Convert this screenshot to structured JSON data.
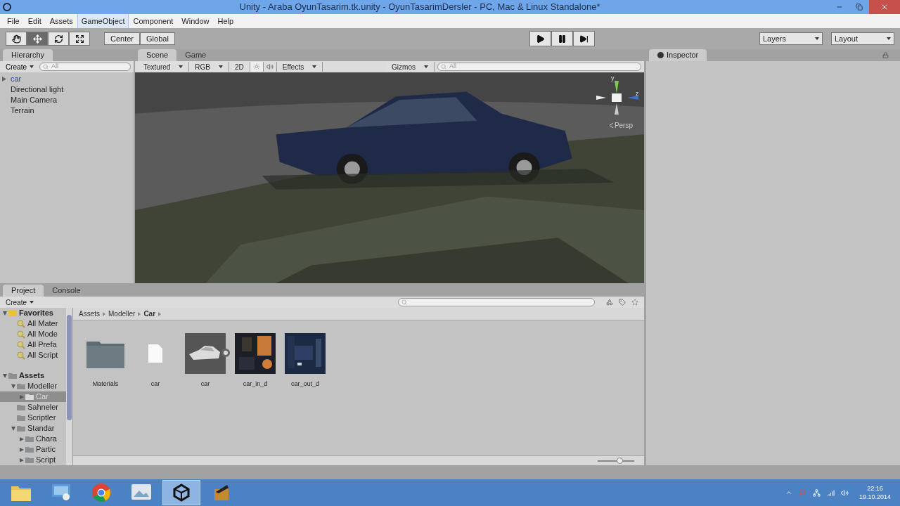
{
  "window": {
    "title": "Unity - Araba OyunTasarim.tk.unity - OyunTasarimDersler - PC, Mac & Linux Standalone*"
  },
  "menu": [
    {
      "label": "File",
      "highlighted": false
    },
    {
      "label": "Edit",
      "highlighted": false
    },
    {
      "label": "Assets",
      "highlighted": false
    },
    {
      "label": "GameObject",
      "highlighted": true
    },
    {
      "label": "Component",
      "highlighted": false
    },
    {
      "label": "Window",
      "highlighted": false
    },
    {
      "label": "Help",
      "highlighted": false
    }
  ],
  "toolbar": {
    "tools": [
      {
        "kind": "hand",
        "selected": false
      },
      {
        "kind": "move",
        "selected": true
      },
      {
        "kind": "rotate",
        "selected": false
      },
      {
        "kind": "scale",
        "selected": false
      }
    ],
    "pivot": [
      "Center",
      "Global"
    ],
    "playback": [
      {
        "kind": "play"
      },
      {
        "kind": "pause"
      },
      {
        "kind": "step"
      }
    ],
    "layers": "Layers",
    "layout": "Layout"
  },
  "hierarchy": {
    "tab": "Hierarchy",
    "create": "Create",
    "search_placeholder": "All",
    "items": [
      {
        "label": "car",
        "kind": "prefab"
      },
      {
        "label": "Directional light",
        "kind": "object"
      },
      {
        "label": "Main Camera",
        "kind": "object"
      },
      {
        "label": "Terrain",
        "kind": "object"
      }
    ]
  },
  "scene": {
    "tabs": [
      {
        "label": "Scene",
        "selected": true
      },
      {
        "label": "Game",
        "selected": false
      }
    ],
    "toolbar": [
      {
        "kind": "dropdown",
        "label": "Textured"
      },
      {
        "kind": "dropdown",
        "label": "RGB"
      },
      {
        "kind": "toggle",
        "label": "2D"
      },
      {
        "kind": "light"
      },
      {
        "kind": "audio"
      },
      {
        "kind": "dropdown",
        "label": "Effects"
      },
      {
        "kind": "spacer"
      },
      {
        "kind": "dropdown",
        "label": "Gizmos"
      },
      {
        "kind": "search",
        "placeholder": "All"
      }
    ],
    "gizmo": {
      "y": "y",
      "z": "z",
      "projection": "Persp"
    }
  },
  "inspector": {
    "tab": "Inspector"
  },
  "project": {
    "tabs": [
      {
        "label": "Project",
        "selected": true
      },
      {
        "label": "Console",
        "selected": false
      }
    ],
    "create": "Create",
    "tree": [
      {
        "label": "Favorites",
        "kind": "favorites",
        "expanded": true,
        "selected": false,
        "children": [
          {
            "label": "All Mater",
            "kind": "search",
            "selected": false
          },
          {
            "label": "All Mode",
            "kind": "search",
            "selected": false
          },
          {
            "label": "All Prefa",
            "kind": "search",
            "selected": false
          },
          {
            "label": "All Script",
            "kind": "search",
            "selected": false
          }
        ]
      },
      {
        "label": "Assets",
        "kind": "root",
        "expanded": true,
        "selected": false,
        "children": [
          {
            "label": "Modeller",
            "kind": "folder",
            "expanded": true,
            "selected": false,
            "children": [
              {
                "label": "Car",
                "kind": "folder",
                "expanded": false,
                "selected": true
              }
            ]
          },
          {
            "label": "Sahneler",
            "kind": "folder",
            "selected": false
          },
          {
            "label": "Scriptler",
            "kind": "folder",
            "selected": false
          },
          {
            "label": "Standar",
            "kind": "folder",
            "expanded": true,
            "selected": false,
            "children": [
              {
                "label": "Chara",
                "kind": "folder",
                "expanded": false,
                "selected": false
              },
              {
                "label": "Partic",
                "kind": "folder",
                "expanded": false,
                "selected": false
              },
              {
                "label": "Script",
                "kind": "folder",
                "expanded": false,
                "selected": false
              }
            ]
          }
        ]
      }
    ],
    "breadcrumb": [
      "Assets",
      "Modeller",
      "Car"
    ],
    "assets": [
      {
        "label": "Materials",
        "kind": "folder"
      },
      {
        "label": "car",
        "kind": "file"
      },
      {
        "label": "car",
        "kind": "model"
      },
      {
        "label": "car_in_d",
        "kind": "texture-interior"
      },
      {
        "label": "car_out_d",
        "kind": "texture-exterior"
      }
    ],
    "zoom_slider": {
      "level": 0.6
    }
  },
  "taskbar": {
    "apps": [
      {
        "kind": "explorer",
        "active": false
      },
      {
        "kind": "control-panel",
        "active": false
      },
      {
        "kind": "browser",
        "active": false
      },
      {
        "kind": "image-viewer",
        "active": false
      },
      {
        "kind": "unity",
        "active": true
      },
      {
        "kind": "editor",
        "active": false
      }
    ],
    "time": "22:16",
    "date": "19.10.2014"
  }
}
